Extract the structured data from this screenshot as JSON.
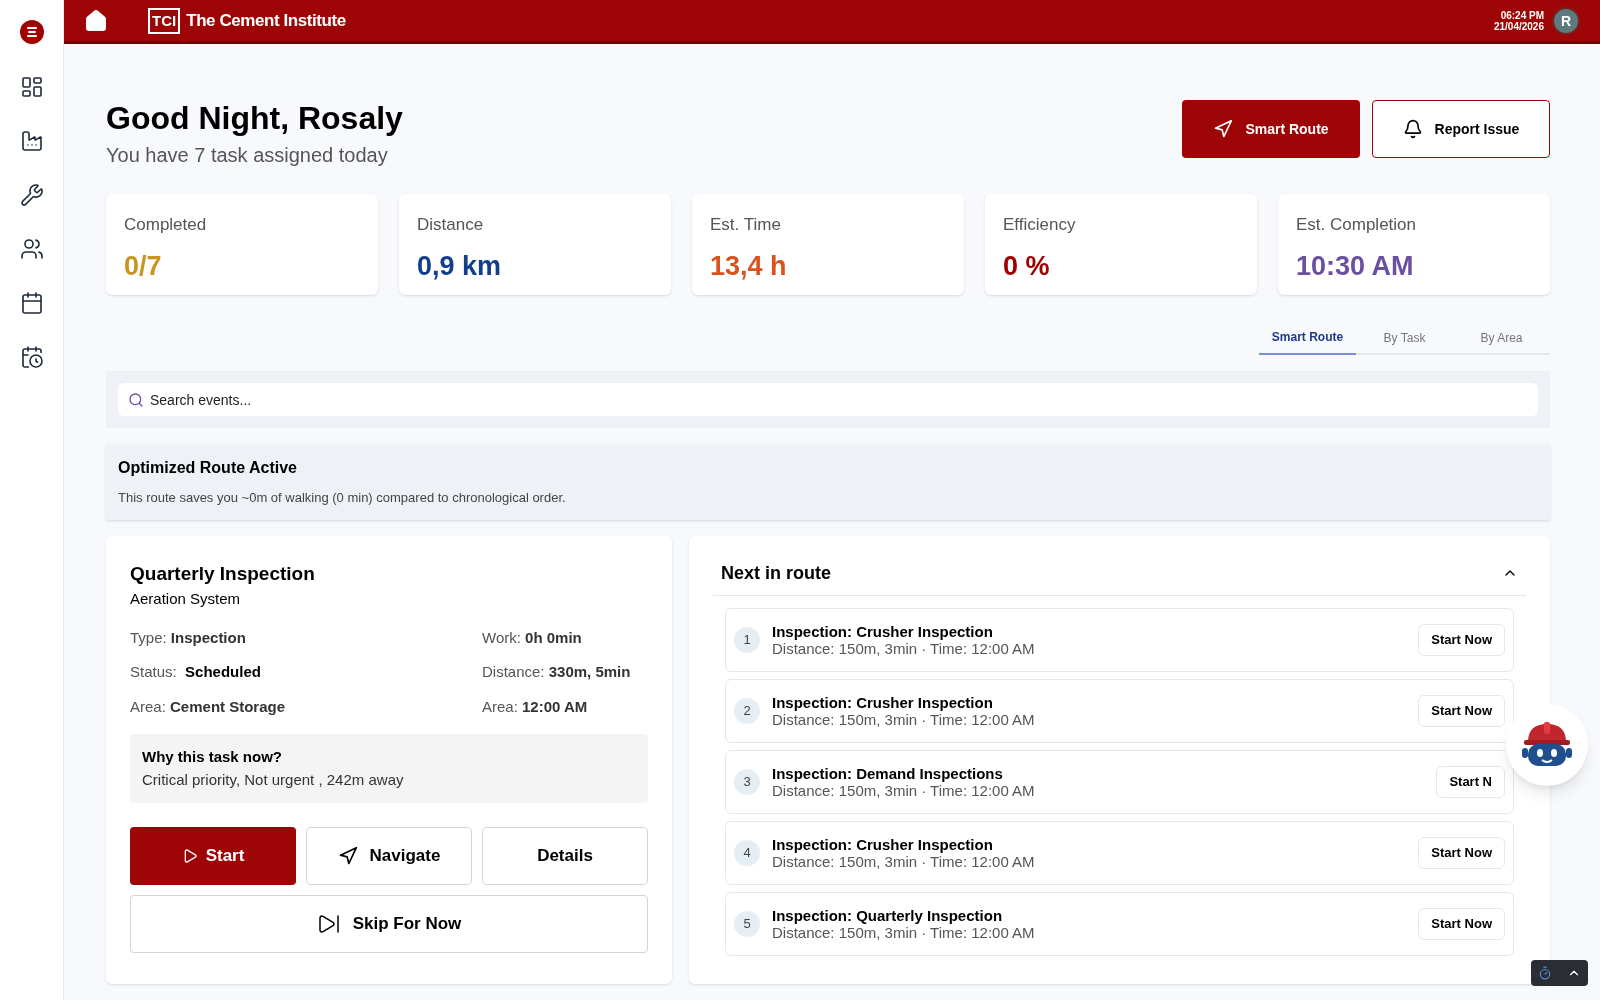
{
  "header": {
    "logo_mark": "TCI",
    "logo_text": "The Cement Institute",
    "time": "06:24 PM",
    "date": "21/04/2026",
    "avatar": "R"
  },
  "sidebar": {
    "items": [
      {
        "kind": "logo"
      },
      {
        "kind": "dashboard"
      },
      {
        "kind": "factory"
      },
      {
        "kind": "wrench"
      },
      {
        "kind": "users"
      },
      {
        "kind": "calendar"
      },
      {
        "kind": "schedule"
      }
    ]
  },
  "greeting": {
    "title": "Good Night, Rosaly",
    "subtitle": "You have 7 task assigned today"
  },
  "actions": [
    {
      "label": "Smart Route",
      "kind": "primary"
    },
    {
      "label": "Report Issue",
      "kind": "secondary"
    }
  ],
  "stats": [
    {
      "label": "Completed",
      "value": "0/7",
      "color": "#c8961e"
    },
    {
      "label": "Distance",
      "value": "0,9 km",
      "color": "#123f8c"
    },
    {
      "label": "Est. Time",
      "value": "13,4 h",
      "color": "#d9531e"
    },
    {
      "label": "Efficiency",
      "value": "0 %",
      "color": "#a00000"
    },
    {
      "label": "Est. Completion",
      "value": "10:30 AM",
      "color": "#6b4fa0"
    }
  ],
  "tabs": [
    {
      "label": "Smart Route",
      "selected": true
    },
    {
      "label": "By Task",
      "selected": false
    },
    {
      "label": "By Area",
      "selected": false
    }
  ],
  "search": {
    "placeholder": "Search events..."
  },
  "route_banner": {
    "title": "Optimized Route Active",
    "text": "This route saves you ~0m of walking (0 min) compared to chronological order."
  },
  "current_task": {
    "title": "Quarterly Inspection",
    "subtitle": "Aeration System",
    "fields": [
      {
        "label": "Type:",
        "value": "Inspection",
        "kind": "normal"
      },
      {
        "label": "Work:",
        "value": "0h 0min",
        "kind": "normal"
      },
      {
        "label": "Status:",
        "value": "Scheduled",
        "kind": "strong"
      },
      {
        "label": "Distance:",
        "value": "330m, 5min",
        "kind": "normal"
      },
      {
        "label": "Area:",
        "value": "Cement Storage",
        "kind": "normal"
      },
      {
        "label": "Area:",
        "value": "12:00 AM",
        "kind": "normal"
      }
    ],
    "reason": {
      "title": "Why this task now?",
      "text": "Critical priority, Not urgent , 242m away"
    },
    "buttons": [
      {
        "label": "Start",
        "kind": "start"
      },
      {
        "label": "Navigate",
        "kind": "navigate"
      },
      {
        "label": "Details",
        "kind": "details"
      },
      {
        "label": "Skip For Now",
        "kind": "skip"
      }
    ]
  },
  "next_in_route": {
    "title": "Next in route",
    "expanded": true,
    "items": [
      {
        "number": "1",
        "title": "Inspection: Crusher Inspection",
        "detail": "Distance: 150m, 3min · Time: 12:00 AM",
        "button": "Start Now"
      },
      {
        "number": "2",
        "title": "Inspection: Crusher Inspection",
        "detail": "Distance: 150m, 3min · Time: 12:00 AM",
        "button": "Start Now"
      },
      {
        "number": "3",
        "title": "Inspection: Demand Inspections",
        "detail": "Distance: 150m, 3min · Time: 12:00 AM",
        "button": "Start N"
      },
      {
        "number": "4",
        "title": "Inspection: Crusher Inspection",
        "detail": "Distance: 150m, 3min · Time: 12:00 AM",
        "button": "Start Now"
      },
      {
        "number": "5",
        "title": "Inspection: Quarterly Inspection",
        "detail": "Distance: 150m, 3min · Time: 12:00 AM",
        "button": "Start Now"
      }
    ]
  }
}
